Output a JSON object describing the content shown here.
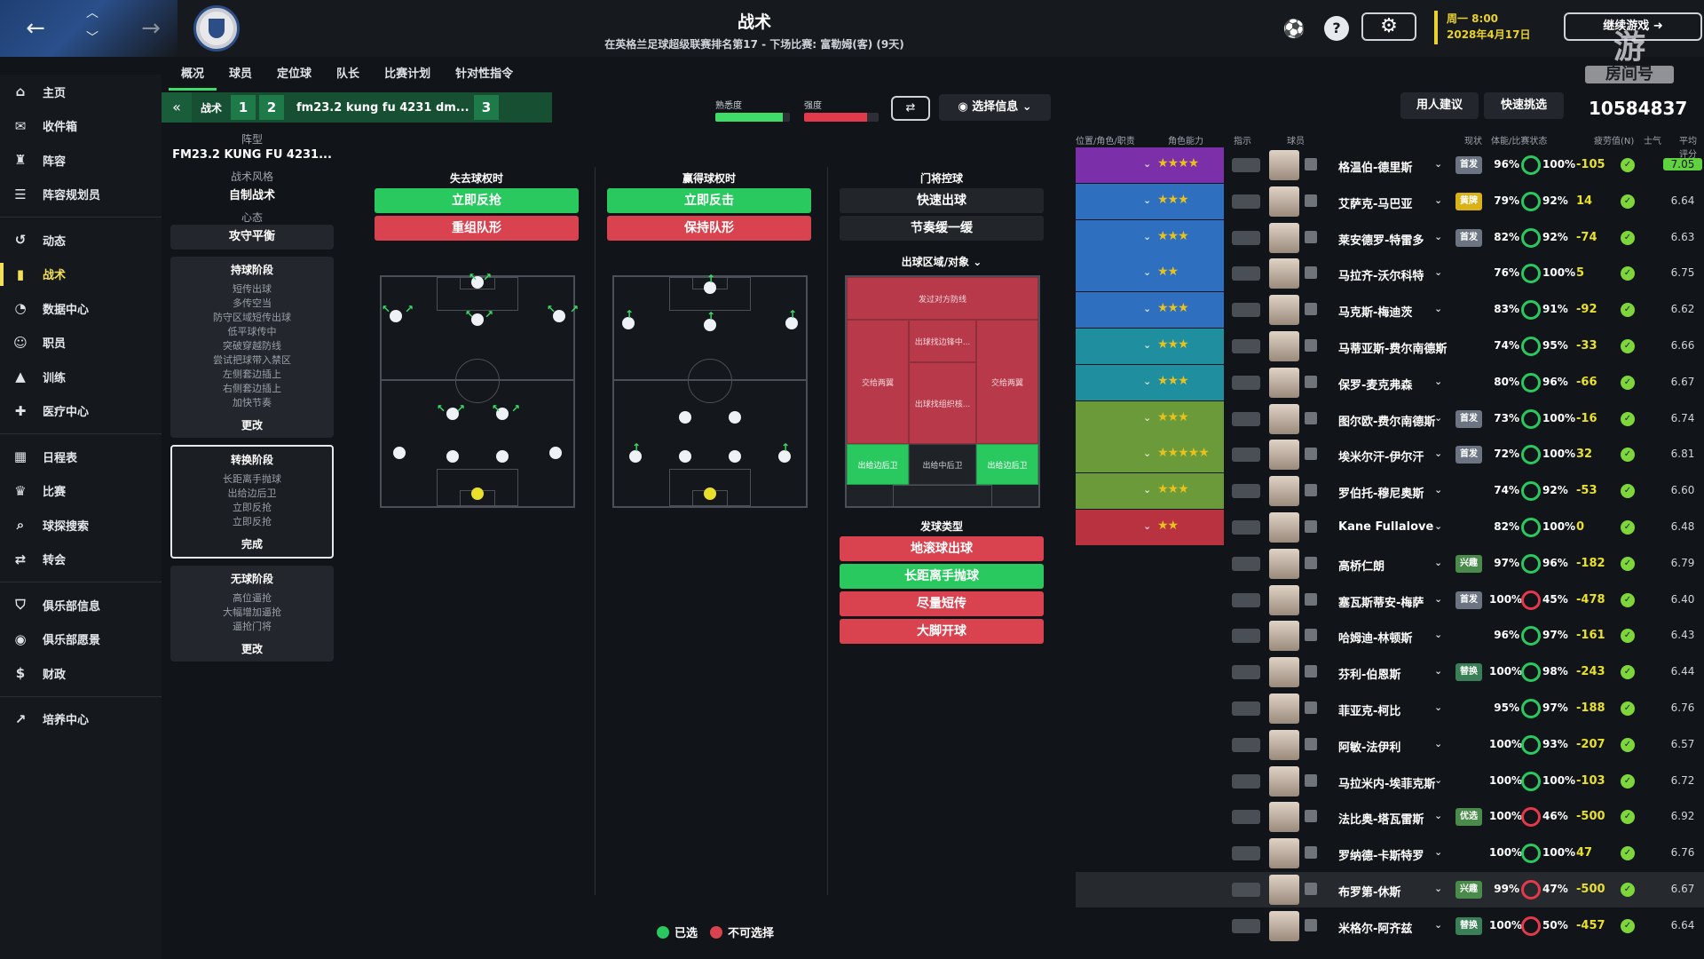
{
  "header": {
    "title": "战术",
    "subtitle": "在英格兰足球超级联赛排名第17 - 下场比赛: 富勒姆(客) (9天)",
    "date_line1": "周一 8:00",
    "date_line2": "2028年4月17日",
    "continue_label": "继续游戏",
    "watermark": "游",
    "watermark_sub": "房间号",
    "help": "?"
  },
  "sidebar": {
    "items": [
      {
        "label": "主页",
        "icon": "⌂"
      },
      {
        "label": "收件箱",
        "icon": "✉"
      },
      {
        "label": "阵容",
        "icon": "♜"
      },
      {
        "label": "阵容规划员",
        "icon": "☰"
      },
      {
        "label": "动态",
        "icon": "↺"
      },
      {
        "label": "战术",
        "icon": "▮"
      },
      {
        "label": "数据中心",
        "icon": "◔"
      },
      {
        "label": "职员",
        "icon": "☺"
      },
      {
        "label": "训练",
        "icon": "▲"
      },
      {
        "label": "医疗中心",
        "icon": "✚"
      },
      {
        "label": "日程表",
        "icon": "▦"
      },
      {
        "label": "比赛",
        "icon": "♛"
      },
      {
        "label": "球探搜索",
        "icon": "⌕"
      },
      {
        "label": "转会",
        "icon": "⇄"
      },
      {
        "label": "俱乐部信息",
        "icon": "⛉"
      },
      {
        "label": "俱乐部愿景",
        "icon": "◉"
      },
      {
        "label": "财政",
        "icon": "$"
      },
      {
        "label": "培养中心",
        "icon": "↗"
      }
    ]
  },
  "tabs": [
    "概况",
    "球员",
    "定位球",
    "队长",
    "比赛计划",
    "针对性指令"
  ],
  "tactic_bar": {
    "label": "战术",
    "slots": [
      "1",
      "2",
      "3"
    ],
    "name": "fm23.2 kung fu 4231 dm...",
    "familiarity_label": "熟悉度",
    "familiarity": 0.9,
    "intensity_label": "强度",
    "intensity": 0.85,
    "select_info": "选择信息",
    "staff_advice": "用人建议",
    "quick_pick": "快速挑选",
    "cash": "10584837"
  },
  "left": {
    "formation_label": "阵型",
    "formation": "FM23.2 KUNG FU 4231...",
    "style_label": "战术风格",
    "style": "自制战术",
    "mentality_label": "心态",
    "mentality": "攻守平衡",
    "phases": [
      {
        "title": "持球阶段",
        "items": [
          "短传出球",
          "多传空当",
          "防守区域短传出球",
          "低平球传中",
          "突破穿越防线",
          "尝试把球带入禁区",
          "左侧套边插上",
          "右侧套边插上",
          "加快节奏"
        ],
        "more": "更改"
      },
      {
        "title": "转换阶段",
        "items": [
          "长距离手抛球",
          "出给边后卫",
          "立即反抢",
          "立即反抢"
        ],
        "more": "完成"
      },
      {
        "title": "无球阶段",
        "items": [
          "高位逼抢",
          "大幅增加逼抢",
          "逼抢门将"
        ],
        "more": "更改"
      }
    ]
  },
  "instructions": {
    "lose_title": "失去球权时",
    "lose_options": [
      "立即反抢",
      "重组队形"
    ],
    "win_title": "赢得球权时",
    "win_options": [
      "立即反击",
      "保持队形"
    ],
    "gk_title": "门将控球",
    "gk_options": [
      "快速出球",
      "节奏缓一缓"
    ],
    "zone_title": "出球区域/对象",
    "zones": {
      "top": "发过对方防线",
      "mid_top": "出球找边锋中...",
      "left": "交给两翼",
      "right": "交给两翼",
      "mid": "出球找组织核...",
      "bl": "出给边后卫",
      "bc": "出给中后卫",
      "br": "出给边后卫"
    },
    "dist_title": "发球类型",
    "dist_options": [
      "地滚球出球",
      "长距离手抛球",
      "尽量短传",
      "大脚开球"
    ]
  },
  "legend": {
    "selected": "已选",
    "unavailable": "不可选择"
  },
  "squad": {
    "headers": [
      "位置/角色/职责",
      "角色能力",
      "指示",
      "球员",
      "现状",
      "体能/比赛状态",
      "疲劳值(N)",
      "士气",
      "平均评分"
    ],
    "players": [
      {
        "name": "格温伯-德里斯",
        "stars": "★★★★",
        "half": true,
        "tag": "首发",
        "fit": "96%",
        "cond": "100%",
        "val": "-105",
        "avg": "7.05",
        "band": "#7b2fa8",
        "best": true
      },
      {
        "name": "艾萨克-马巴亚",
        "stars": "★★★",
        "tag": "黄牌",
        "fit": "79%",
        "cond": "92%",
        "val": "14",
        "avg": "6.64",
        "band": "#2f6fbf"
      },
      {
        "name": "莱安德罗-特雷多",
        "stars": "★★★",
        "tag": "首发",
        "fit": "82%",
        "cond": "92%",
        "val": "-74",
        "avg": "6.63",
        "band": "#2f6fbf"
      },
      {
        "name": "马拉齐-沃尔科特",
        "stars": "★★",
        "half": true,
        "tag": "",
        "fit": "76%",
        "cond": "100%",
        "val": "5",
        "avg": "6.75",
        "band": "#2f6fbf"
      },
      {
        "name": "马克斯-梅迪茨",
        "stars": "★★★",
        "tag": "",
        "fit": "83%",
        "cond": "91%",
        "val": "-92",
        "avg": "6.62",
        "band": "#2f6fbf"
      },
      {
        "name": "马蒂亚斯-费尔南德斯",
        "stars": "★★★",
        "half": true,
        "tag": "",
        "fit": "74%",
        "cond": "95%",
        "val": "-33",
        "avg": "6.66",
        "band": "#1f8fa0"
      },
      {
        "name": "保罗-麦克弗森",
        "stars": "★★★",
        "tag": "",
        "fit": "80%",
        "cond": "96%",
        "val": "-66",
        "avg": "6.67",
        "band": "#1f8fa0"
      },
      {
        "name": "图尔欧-费尔南德斯",
        "stars": "★★★",
        "half": true,
        "tag": "首发",
        "fit": "73%",
        "cond": "100%",
        "val": "-16",
        "avg": "6.74",
        "band": "#6a9a3a"
      },
      {
        "name": "埃米尔汗-伊尔汗",
        "stars": "★★★★★",
        "tag": "首发",
        "fit": "72%",
        "cond": "100%",
        "val": "32",
        "avg": "6.81",
        "band": "#6a9a3a"
      },
      {
        "name": "罗伯托-穆尼奥斯",
        "stars": "★★★",
        "tag": "",
        "fit": "74%",
        "cond": "92%",
        "val": "-53",
        "avg": "6.60",
        "band": "#6a9a3a"
      },
      {
        "name": "Kane Fullalove",
        "stars": "★★",
        "tag": "",
        "fit": "82%",
        "cond": "100%",
        "val": "0",
        "avg": "6.48",
        "band": "#b8323f"
      },
      {
        "name": "高桥仁朗",
        "stars": "",
        "tag": "兴趣",
        "fit": "97%",
        "cond": "96%",
        "val": "-182",
        "avg": "6.79",
        "band": ""
      },
      {
        "name": "塞瓦斯蒂安-梅萨",
        "stars": "",
        "tag": "首发",
        "fit": "100%",
        "cond": "45%",
        "val": "-478",
        "avg": "6.40",
        "band": ""
      },
      {
        "name": "哈姆迪-林顿斯",
        "stars": "",
        "tag": "",
        "fit": "96%",
        "cond": "97%",
        "val": "-161",
        "avg": "6.43",
        "band": ""
      },
      {
        "name": "芬利-伯恩斯",
        "stars": "",
        "tag": "替换",
        "fit": "100%",
        "cond": "98%",
        "val": "-243",
        "avg": "6.44",
        "band": ""
      },
      {
        "name": "菲亚克-柯比",
        "stars": "",
        "tag": "",
        "fit": "95%",
        "cond": "97%",
        "val": "-188",
        "avg": "6.76",
        "band": ""
      },
      {
        "name": "阿敏-法伊利",
        "stars": "",
        "tag": "",
        "fit": "100%",
        "cond": "93%",
        "val": "-207",
        "avg": "6.57",
        "band": ""
      },
      {
        "name": "马拉米内-埃菲克斯",
        "stars": "",
        "tag": "",
        "fit": "100%",
        "cond": "100%",
        "val": "-103",
        "avg": "6.72",
        "band": ""
      },
      {
        "name": "法比奥-塔瓦雷斯",
        "stars": "",
        "tag": "优选",
        "fit": "100%",
        "cond": "46%",
        "val": "-500",
        "avg": "6.92",
        "band": ""
      },
      {
        "name": "罗纳德-卡斯特罗",
        "stars": "",
        "tag": "",
        "fit": "100%",
        "cond": "100%",
        "val": "47",
        "avg": "6.76",
        "band": ""
      },
      {
        "name": "布罗第-休斯",
        "stars": "",
        "tag": "兴趣",
        "fit": "99%",
        "cond": "47%",
        "val": "-500",
        "avg": "6.67",
        "band": "",
        "hl": true
      },
      {
        "name": "米格尔-阿齐兹",
        "stars": "",
        "tag": "替换",
        "fit": "100%",
        "cond": "50%",
        "val": "-457",
        "avg": "6.64",
        "band": ""
      }
    ]
  }
}
